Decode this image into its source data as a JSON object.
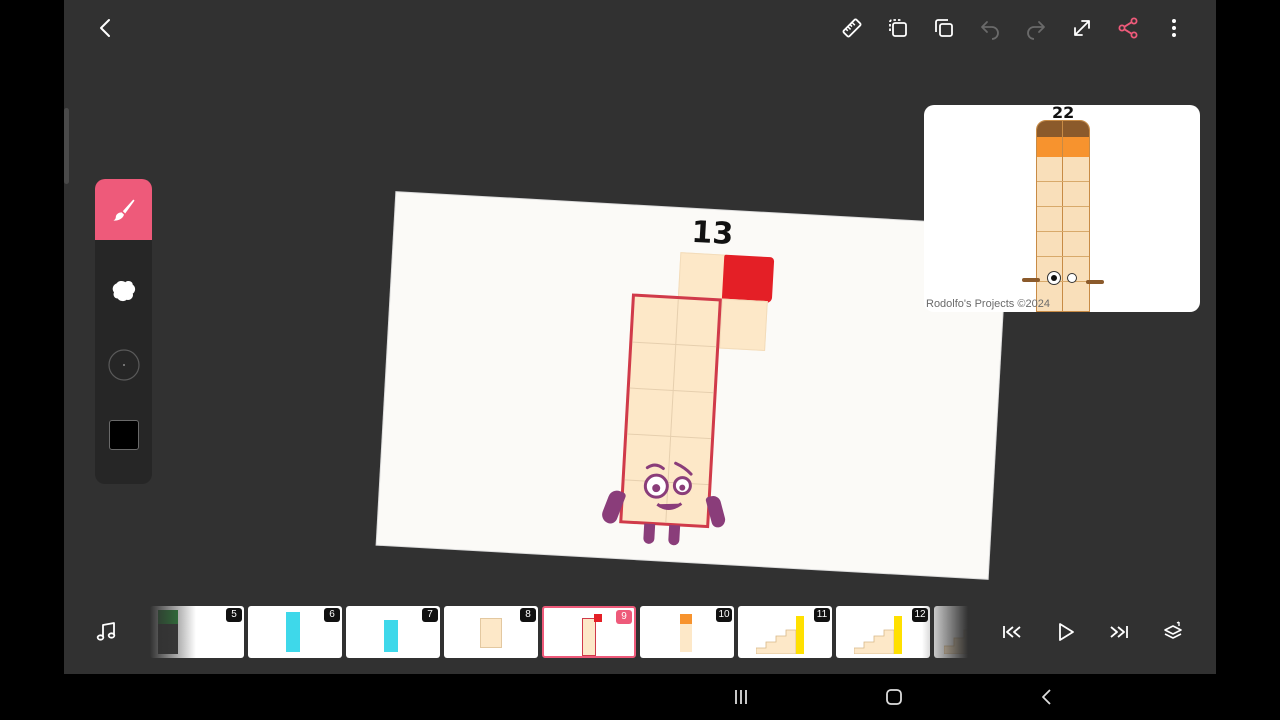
{
  "toolbar": {
    "icons": [
      "back-chevron-icon",
      "ruler-icon",
      "copy-frame-icon",
      "duplicate-frame-icon",
      "undo-icon",
      "redo-icon",
      "expand-icon",
      "share-icon",
      "more-vertical-icon"
    ],
    "accent": "#ee5a7a",
    "undo_enabled": false,
    "redo_enabled": false
  },
  "palette": {
    "tools": [
      "brush-icon",
      "eraser-blob-icon",
      "brush-size-dot",
      "color-swatch"
    ],
    "active_tool": "brush",
    "current_color": "#000000"
  },
  "canvas": {
    "character_number": "13",
    "character_colors": {
      "block": "#fde8c8",
      "border": "#d03a4a",
      "flag": "#e41f26",
      "face": "#8a3d7a"
    }
  },
  "preview": {
    "character_number": "22",
    "credit": "Rodolfo's Projects ©2024"
  },
  "timeline": {
    "frames": [
      {
        "label": "5"
      },
      {
        "label": "6"
      },
      {
        "label": "7"
      },
      {
        "label": "8"
      },
      {
        "label": "9",
        "selected": true
      },
      {
        "label": "10"
      },
      {
        "label": "11"
      },
      {
        "label": "12"
      },
      {
        "label": ""
      }
    ],
    "controls": [
      "music-icon",
      "skip-first-icon",
      "play-icon",
      "skip-last-icon",
      "layers-icon"
    ]
  },
  "system_nav": [
    "recents-icon",
    "home-icon",
    "back-icon"
  ]
}
